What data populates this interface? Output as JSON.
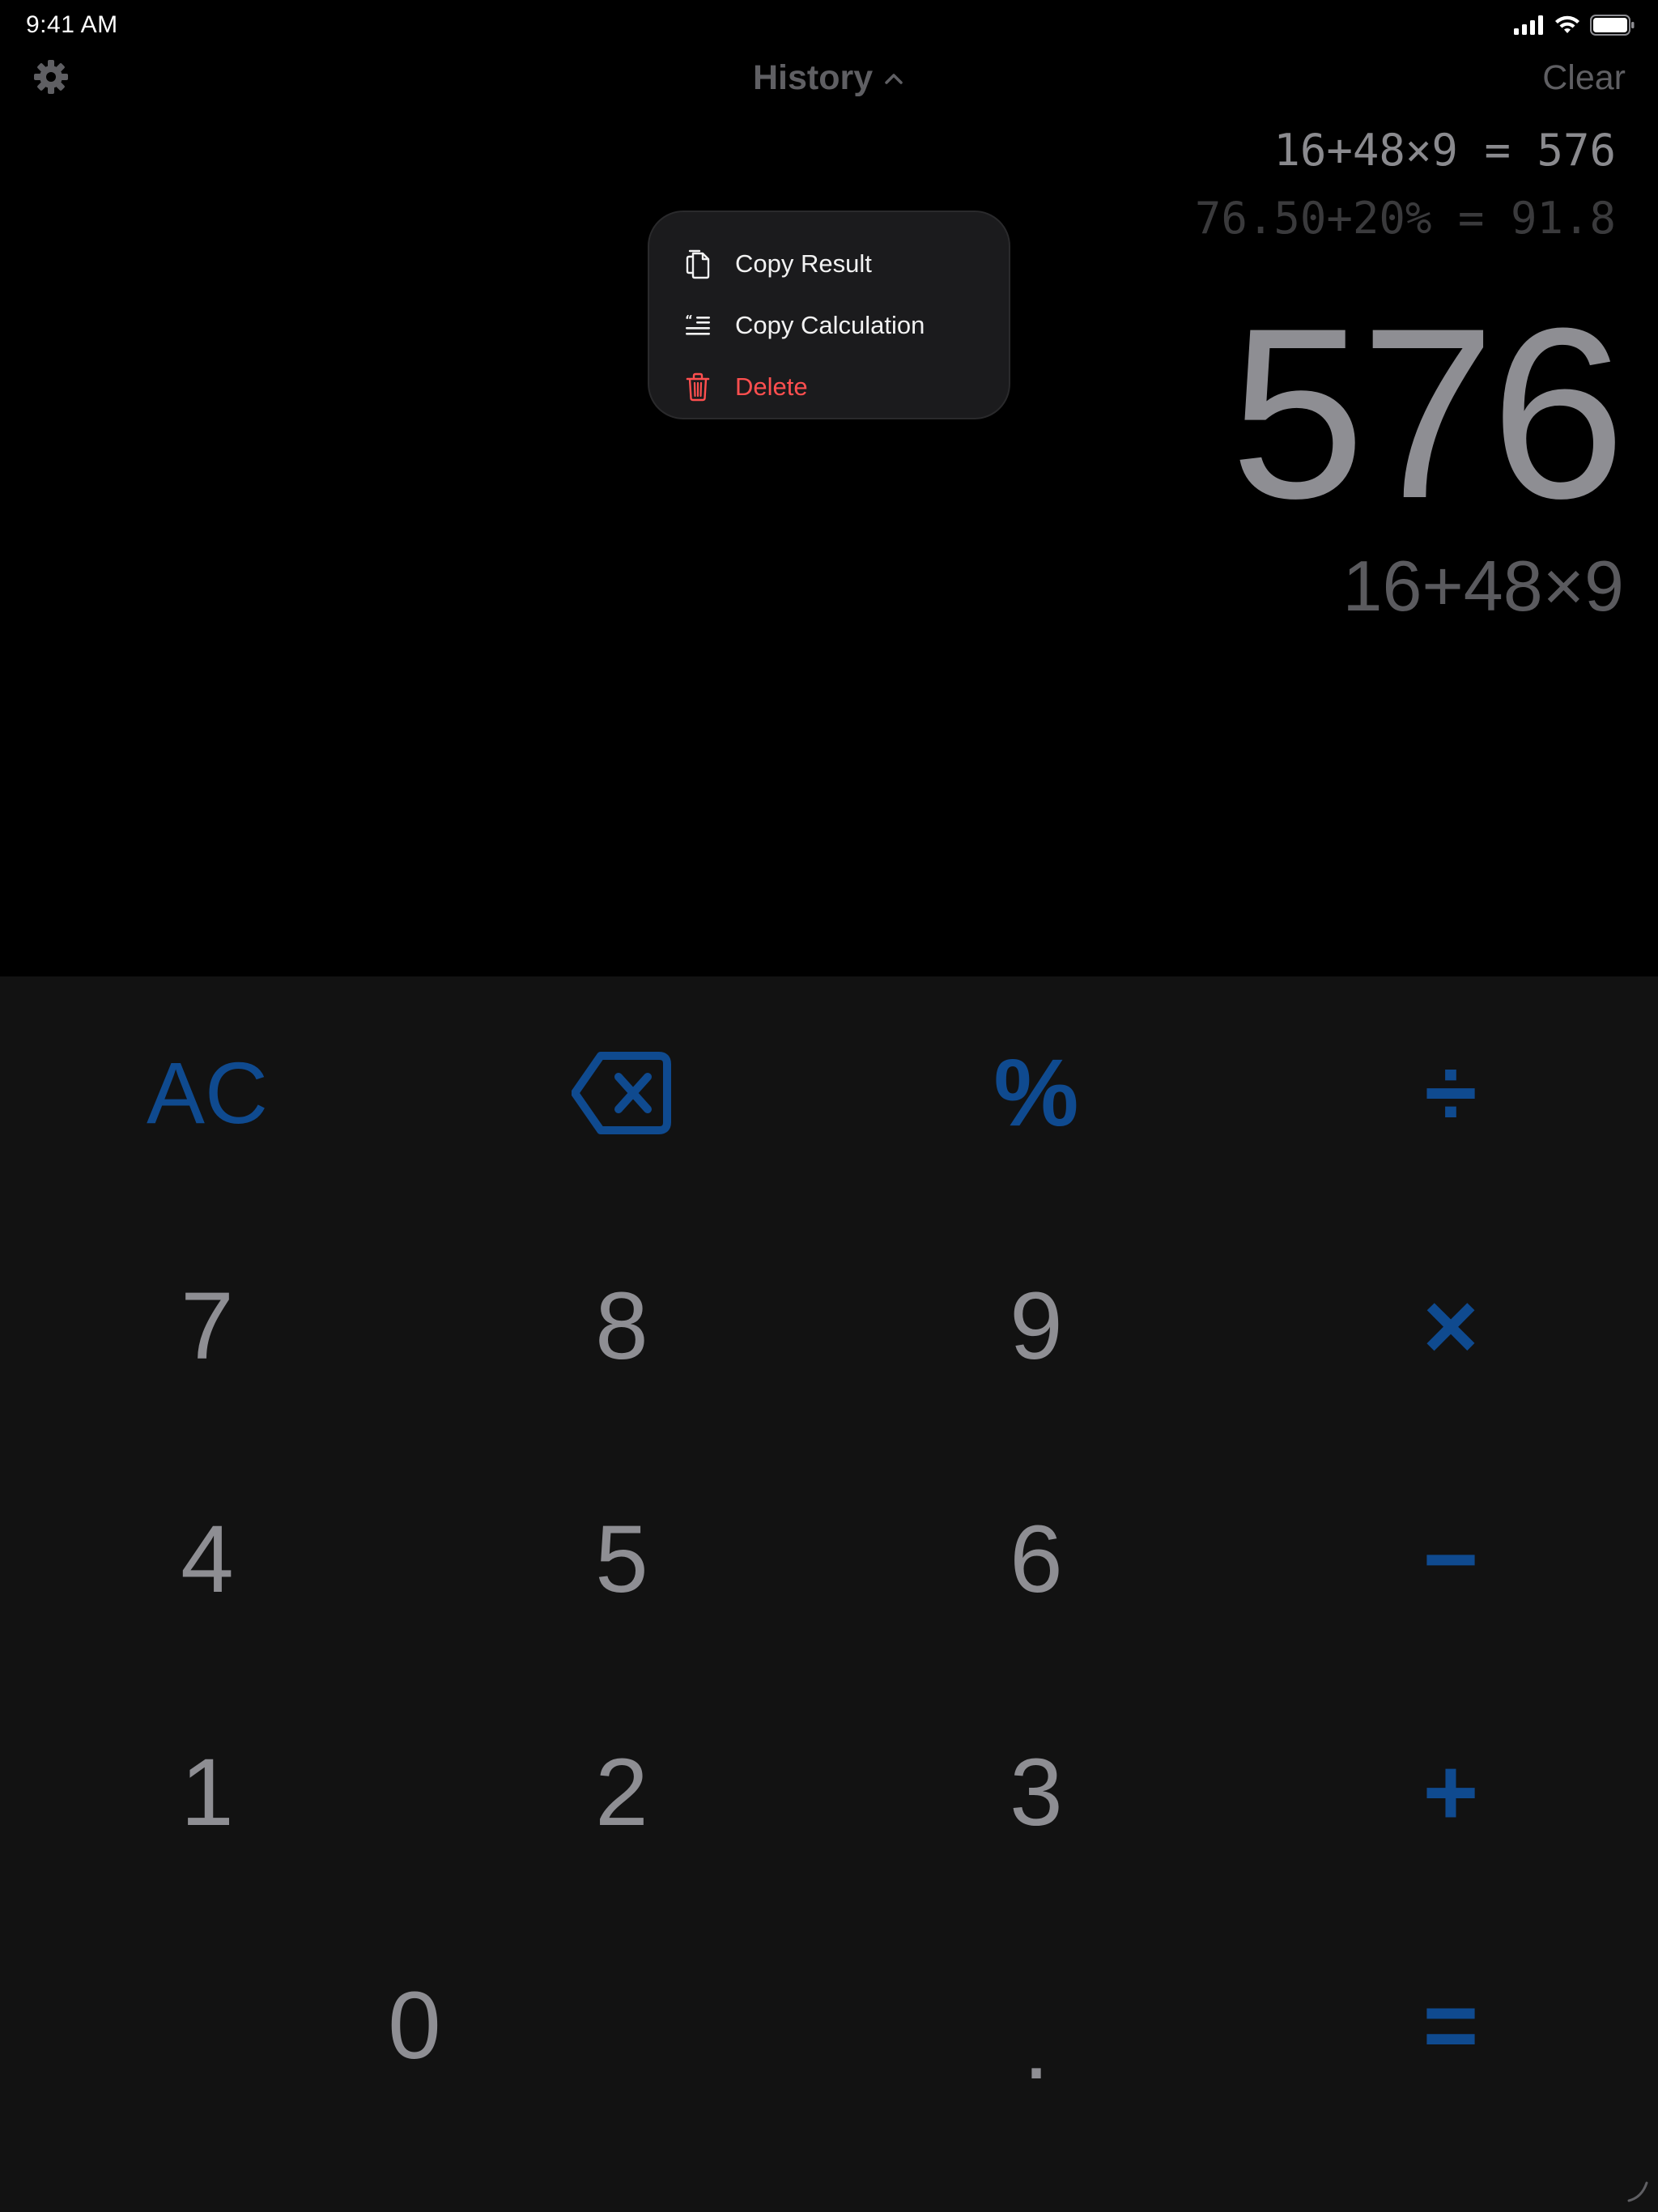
{
  "status_bar": {
    "time": "9:41 AM"
  },
  "top_bar": {
    "history_label": "History",
    "clear_label": "Clear"
  },
  "history": [
    {
      "text": "16+48×9 = 576"
    },
    {
      "text": "76.50+20% = 91.8"
    }
  ],
  "display": {
    "result": "576",
    "expression": "16+48×9"
  },
  "context_menu": {
    "items": [
      {
        "label": "Copy Result",
        "icon": "copy-icon"
      },
      {
        "label": "Copy Calculation",
        "icon": "copy-calculation-icon"
      },
      {
        "label": "Delete",
        "icon": "trash-icon"
      }
    ]
  },
  "keypad": {
    "ac": "AC",
    "percent": "%",
    "divide": "÷",
    "multiply": "×",
    "minus": "−",
    "plus": "+",
    "equals": "=",
    "seven": "7",
    "eight": "8",
    "nine": "9",
    "four": "4",
    "five": "5",
    "six": "6",
    "one": "1",
    "two": "2",
    "three": "3",
    "zero": "0",
    "decimal": "."
  },
  "colors": {
    "accent": "#0f4a8f",
    "digits": "#8e8e93",
    "danger": "#ff4f4f",
    "keypad_bg": "#121212",
    "menu_bg": "#1b1b1d"
  }
}
